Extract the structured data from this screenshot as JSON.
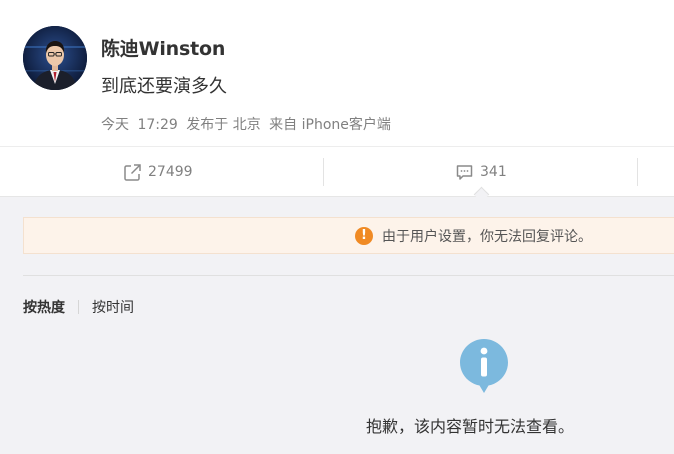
{
  "post": {
    "author": "陈迪Winston",
    "text": "到底还要演多久",
    "meta": {
      "date": "今天",
      "time": "17:29",
      "published": "发布于 北京",
      "source": "来自 iPhone客户端"
    }
  },
  "actions": {
    "forward": {
      "icon": "share-icon",
      "count": "27499"
    },
    "comment": {
      "icon": "comment-icon",
      "count": "341"
    }
  },
  "notice": {
    "icon": "exclamation-icon",
    "text": "由于用户设置，你无法回复评论。",
    "color": "#f08a24"
  },
  "sort": {
    "tabs": [
      {
        "label": "按热度",
        "active": true
      },
      {
        "label": "按时间",
        "active": false
      }
    ]
  },
  "empty_state": {
    "icon": "info-icon",
    "text": "抱歉，该内容暂时无法查看。",
    "icon_color": "#7cb9de"
  }
}
